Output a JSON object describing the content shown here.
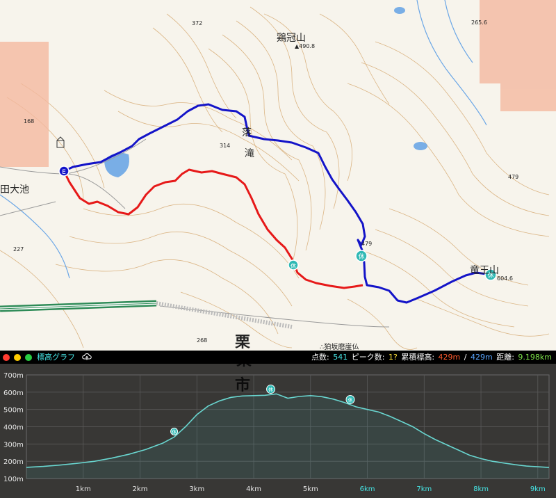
{
  "map": {
    "labels": {
      "mountain_keikan": "鶏冠山",
      "elev_keikan": "▲490.8",
      "mountain_ryuo": "竜王山",
      "elev_ryuo": "604.6",
      "spot_372": "372",
      "spot_2656": "265.6",
      "spot_168": "168",
      "spot_314": "314",
      "spot_479": "479",
      "spot_227": "227",
      "spot_268": "268",
      "spot_479b": "479",
      "pond": "田大池",
      "waterfall_1": "落",
      "waterfall_2": "滝",
      "city_1": "栗",
      "city_2": "東",
      "city_3": "市",
      "landmark": "∴狛坂磨崖仏"
    },
    "rest_marker": "休",
    "end_marker": "E",
    "colors": {
      "route_blue": "#1414c8",
      "route_red": "#e61919",
      "rest_fill": "#2fb9b4",
      "contour": "#d6aa72",
      "water": "#6aa6e6",
      "highway": "#2e8b57"
    }
  },
  "graph": {
    "title": "標高グラフ",
    "cloud_icon": "cloud-upload-icon",
    "stats": {
      "points_label": "点数:",
      "points_value": "541",
      "peaks_label": "ピーク数:",
      "peaks_value": "1?",
      "cum_label": "累積標高:",
      "cum_up": "429m",
      "sep": "/",
      "cum_down": "429m",
      "dist_label": "距離:",
      "dist_value": "9.198km"
    },
    "y_ticks": [
      "700m",
      "600m",
      "500m",
      "400m",
      "300m",
      "200m",
      "100m"
    ],
    "x_ticks": [
      "1km",
      "2km",
      "3km",
      "4km",
      "5km",
      "6km",
      "7km",
      "8km",
      "9km"
    ],
    "rest_marker": "休"
  },
  "chart_data": {
    "type": "area",
    "title": "標高グラフ",
    "xlabel": "",
    "ylabel": "",
    "xlim": [
      0,
      9.198
    ],
    "ylim": [
      100,
      700
    ],
    "grid": true,
    "x": [
      0,
      0.3,
      0.6,
      0.9,
      1.2,
      1.5,
      1.8,
      2.1,
      2.4,
      2.6,
      2.8,
      3.0,
      3.2,
      3.4,
      3.6,
      3.8,
      4.0,
      4.2,
      4.4,
      4.6,
      4.8,
      5.0,
      5.2,
      5.4,
      5.6,
      5.8,
      6.0,
      6.2,
      6.4,
      6.6,
      6.8,
      7.0,
      7.2,
      7.4,
      7.6,
      7.8,
      8.0,
      8.2,
      8.4,
      8.6,
      8.8,
      9.0,
      9.198
    ],
    "y": [
      165,
      170,
      178,
      188,
      200,
      218,
      240,
      268,
      305,
      340,
      400,
      470,
      520,
      550,
      570,
      578,
      580,
      582,
      590,
      565,
      575,
      580,
      574,
      560,
      540,
      515,
      500,
      485,
      460,
      430,
      400,
      360,
      325,
      295,
      265,
      235,
      215,
      200,
      190,
      180,
      172,
      168,
      164
    ],
    "rest_points": [
      {
        "x": 2.6,
        "y": 340
      },
      {
        "x": 4.3,
        "y": 585
      },
      {
        "x": 5.7,
        "y": 525
      }
    ]
  }
}
